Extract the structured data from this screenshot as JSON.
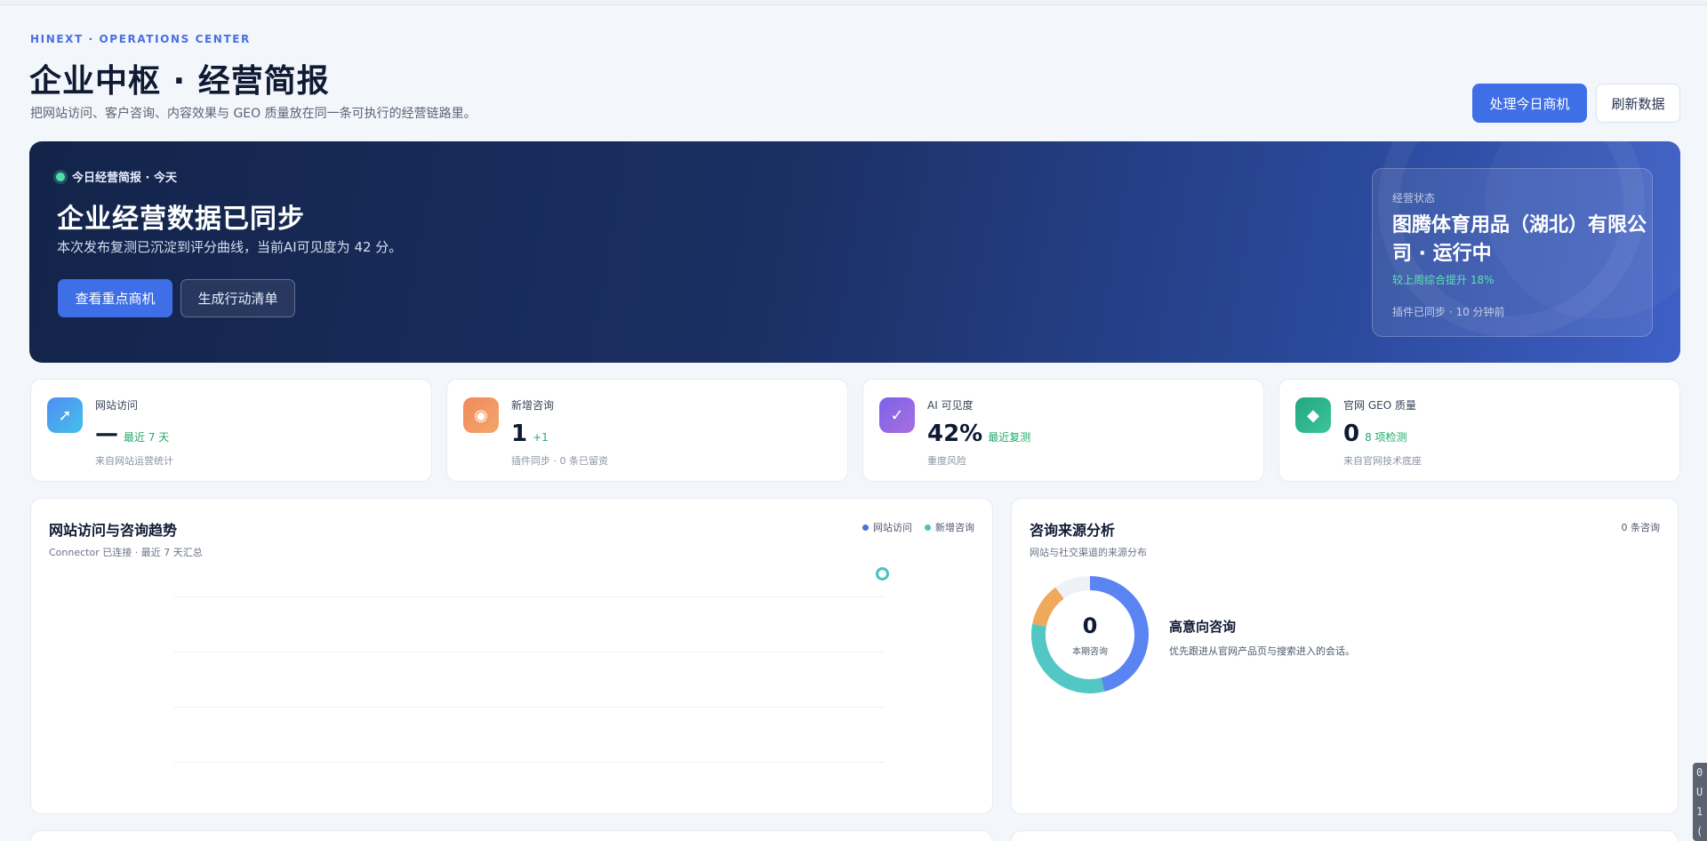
{
  "header": {
    "eyebrow": "HINEXT · OPERATIONS CENTER",
    "title": "企业中枢 · 经营简报",
    "subtitle": "把网站访问、客户咨询、内容效果与 GEO 质量放在同一条可执行的经营链路里。",
    "primary_button": "处理今日商机",
    "secondary_button": "刷新数据"
  },
  "hero": {
    "tag": "今日经营简报 · 今天",
    "title": "企业经营数据已同步",
    "description": "本次发布复测已沉淀到评分曲线，当前AI可见度为 42 分。",
    "primary_button": "查看重点商机",
    "secondary_button": "生成行动清单",
    "status": {
      "label": "经营状态",
      "company": "图腾体育用品（湖北）有限公司 · 运行中",
      "delta": "较上周综合提升 18%",
      "sync": "插件已同步 · 10 分钟前"
    }
  },
  "kpis": [
    {
      "label": "网站访问",
      "value": "—",
      "delta": "最近 7 天",
      "note": "来自网站运营统计",
      "icon": "arrow-icon",
      "color_from": "#4f8df5",
      "color_to": "#44c0e8",
      "glyph": "➚"
    },
    {
      "label": "新增咨询",
      "value": "1",
      "delta": "+1",
      "note": "插件同步 · 0 条已留资",
      "icon": "target-icon",
      "color_from": "#f08a5d",
      "color_to": "#f3a66a",
      "glyph": "◉"
    },
    {
      "label": "AI 可见度",
      "value": "42%",
      "delta": "最近复测",
      "note": "重度风险",
      "icon": "check-icon",
      "color_from": "#7d63e8",
      "color_to": "#a86ee0",
      "glyph": "✓"
    },
    {
      "label": "官网 GEO 质量",
      "value": "0",
      "delta": "8 项检测",
      "note": "来自官网技术底座",
      "icon": "diamond-icon",
      "color_from": "#24a583",
      "color_to": "#3cc59a",
      "glyph": "◆"
    }
  ],
  "trend_panel": {
    "title": "网站访问与咨询趋势",
    "subtitle": "Connector 已连接 · 最近 7 天汇总",
    "legend": [
      {
        "name": "网站访问",
        "color": "#4a6fe0"
      },
      {
        "name": "新增咨询",
        "color": "#47c4c1"
      }
    ]
  },
  "source_panel": {
    "title": "咨询来源分析",
    "subtitle": "网站与社交渠道的来源分布",
    "count": "0 条咨询",
    "center_value": "0",
    "center_label": "本期咨询",
    "highlight_title": "高意向咨询",
    "highlight_desc": "优先跟进从官网产品页与搜索进入的会话。",
    "segments": [
      {
        "share": 0.46,
        "color": "#5b84f3"
      },
      {
        "share": 0.32,
        "color": "#53c7c4"
      },
      {
        "share": 0.12,
        "color": "#f0a95a"
      },
      {
        "share": 0.1,
        "color": "#eef1f6"
      }
    ]
  },
  "side_text": "0\nU\n1\n("
}
